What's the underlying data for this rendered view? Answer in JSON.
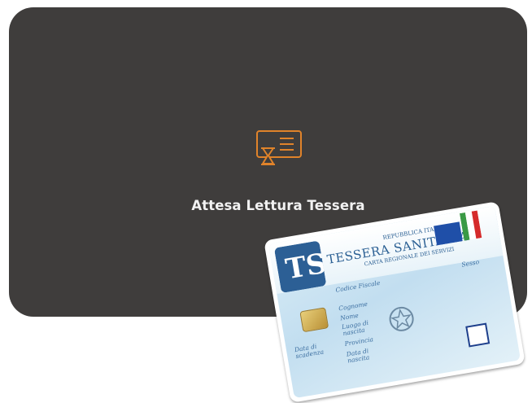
{
  "status": {
    "text": "Attesa Lettura Tessera",
    "icon": "card-reader-hourglass-icon",
    "accent_color": "#e0832a",
    "panel_color": "#3f3d3c"
  },
  "card": {
    "logo_letters": "TS",
    "issuer": "REPUBBLICA ITALIANA",
    "title": "TESSERA SANITARIA",
    "subtitle": "CARTA REGIONALE DEI SERVIZI",
    "fields": {
      "codice_fiscale": "Codice Fiscale",
      "cognome": "Cognome",
      "nome": "Nome",
      "luogo_nascita": "Luogo di nascita",
      "provincia": "Provincia",
      "data_nascita": "Data di nascita",
      "sesso": "Sesso",
      "scadenza": "Data di scadenza"
    }
  }
}
